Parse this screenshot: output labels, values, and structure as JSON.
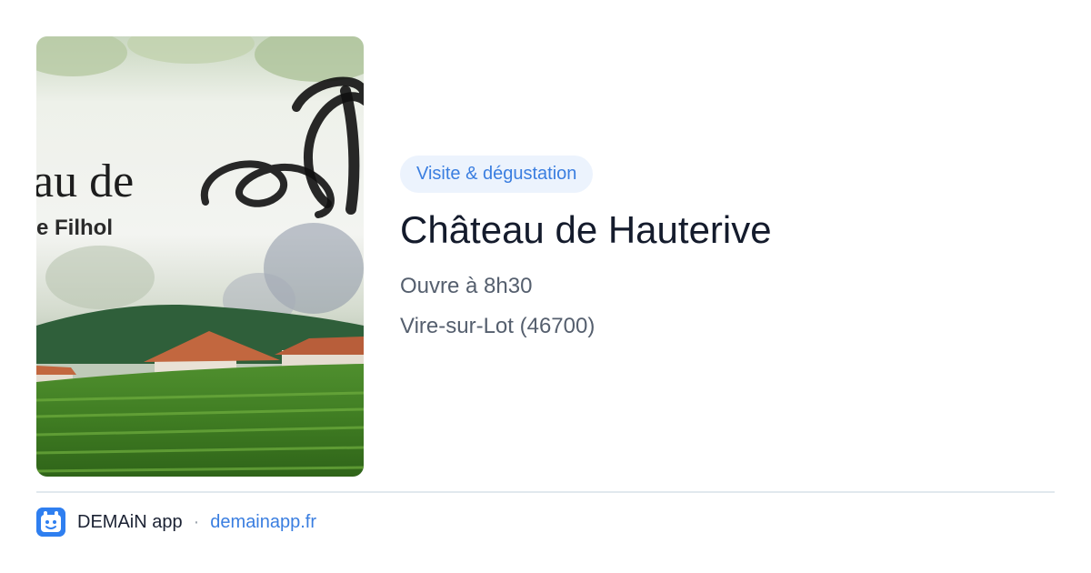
{
  "card": {
    "tag": "Visite & dégustation",
    "title": "Château de Hauterive",
    "hours": "Ouvre à 8h30",
    "location": "Vire-sur-Lot (46700)"
  },
  "photo": {
    "logo_text_partial": "au de",
    "logo_subtitle_partial": "e Filhol"
  },
  "footer": {
    "app_name": "DEMAiN app",
    "separator": "·",
    "url": "demainapp.fr",
    "icon": "demain-app-icon"
  },
  "colors": {
    "accent": "#3a7ee0",
    "tag_background": "#ecf3fd",
    "title": "#141b2c",
    "secondary_text": "#555f6e",
    "divider": "#e1e8ee"
  }
}
